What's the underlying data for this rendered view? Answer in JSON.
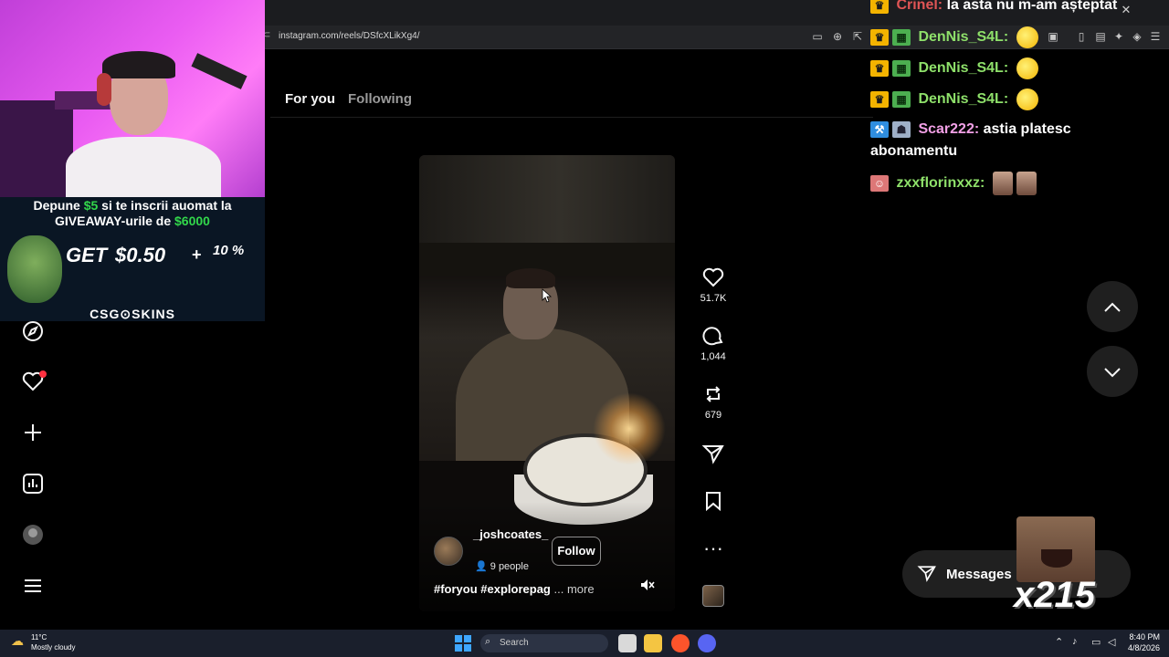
{
  "browser": {
    "url": "instagram.com/reels/DSfcXLikXg4/",
    "toolbar_icons": [
      "picture-in-picture-icon",
      "zoom-icon",
      "share-icon",
      "extensions-icon",
      "sidebar-icon",
      "wallet-icon",
      "leo-ai-icon",
      "shield-icon",
      "menu-icon"
    ]
  },
  "feed": {
    "tabs": [
      {
        "label": "For you",
        "active": true
      },
      {
        "label": "Following",
        "active": false
      }
    ]
  },
  "sidebar": {
    "items": [
      "explore-icon",
      "notifications-heart-icon",
      "create-plus-icon",
      "dashboard-icon",
      "profile-avatar",
      "more-menu-icon"
    ],
    "notification_dot_color": "#ff3040"
  },
  "reel": {
    "username": "_joshcoates_",
    "audience": "9 people",
    "follow_label": "Follow",
    "caption": "#foryou #explorepag",
    "caption_more": "... more",
    "muted": true
  },
  "actions": {
    "likes": "51.7K",
    "comments": "1,044",
    "reposts": "679"
  },
  "messages": {
    "label": "Messages"
  },
  "overlay": {
    "promo": {
      "line1_pre": "Depune ",
      "line1_amount": "$5",
      "line1_post": " si te inscrii auomat la",
      "line2_pre": "GIVEAWAY-urile de ",
      "line2_amount": "$6000",
      "get": "GET",
      "amount": "$0.50",
      "plus": "+",
      "bonus": "10 %",
      "brand": "CSG⊙SKINS",
      "highlight_color": "#32d74b"
    },
    "chat": [
      {
        "user": "Crinel:",
        "message": "la asta nu m-am așteptat",
        "user_color": "#e05555",
        "badges": [
          "crown"
        ]
      },
      {
        "user": "DenNis_S4L:",
        "message": "",
        "user_color": "#8ee06a",
        "badges": [
          "crown",
          "gift"
        ],
        "emote": "ball"
      },
      {
        "user": "DenNis_S4L:",
        "message": "",
        "user_color": "#8ee06a",
        "badges": [
          "crown",
          "gift"
        ],
        "emote": "ball"
      },
      {
        "user": "DenNis_S4L:",
        "message": "",
        "user_color": "#8ee06a",
        "badges": [
          "crown",
          "gift"
        ],
        "emote": "ball"
      },
      {
        "user": "Scar222:",
        "message": "astia platesc",
        "message_cont": "abonamentu",
        "user_color": "#f2a0e6",
        "badges": [
          "hammer",
          "robot"
        ]
      },
      {
        "user": "zxxflorinxxz:",
        "message": "",
        "user_color": "#8ee06a",
        "badges": [
          "pink"
        ],
        "emote": "faces"
      }
    ],
    "combo": "x215"
  },
  "taskbar": {
    "temperature": "11°C",
    "condition": "Mostly cloudy",
    "search_label": "Search",
    "time": "8:40 PM",
    "date": "4/8/2026"
  }
}
